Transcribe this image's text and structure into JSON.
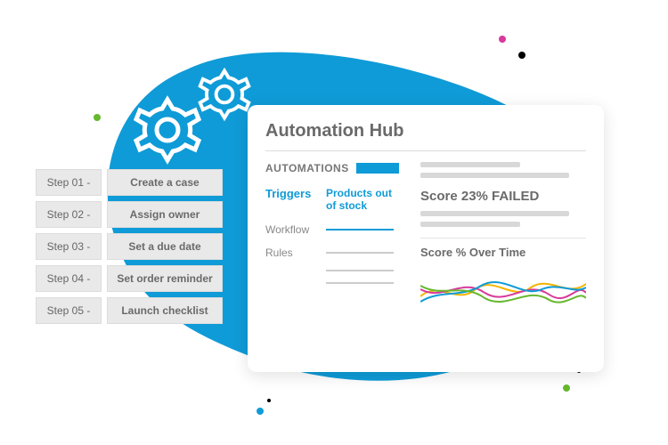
{
  "steps": [
    {
      "tag": "Step 01 -",
      "action": "Create a case"
    },
    {
      "tag": "Step 02 -",
      "action": "Assign owner"
    },
    {
      "tag": "Step 03 -",
      "action": "Set a due date"
    },
    {
      "tag": "Step 04 -",
      "action": "Set order reminder"
    },
    {
      "tag": "Step 05 -",
      "action": "Launch checklist"
    }
  ],
  "card": {
    "title": "Automation Hub",
    "section_heading": "AUTOMATIONS",
    "nav": {
      "triggers": "Triggers",
      "products_out": "Products out of stock",
      "workflow": "Workflow",
      "rules": "Rules"
    },
    "score_line": "Score 23% FAILED",
    "chart_title": "Score % Over Time"
  },
  "colors": {
    "brand_blue": "#0f9bd7",
    "text_gray": "#6a6a6a"
  }
}
